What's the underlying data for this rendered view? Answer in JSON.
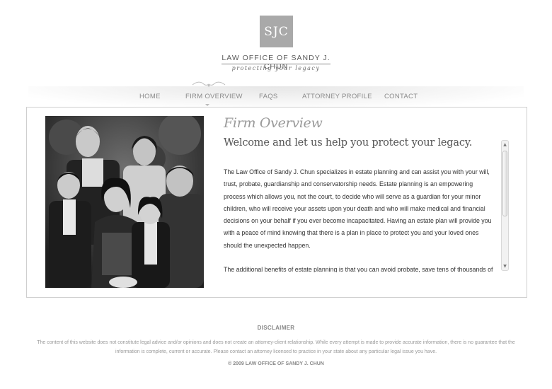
{
  "header": {
    "logo_monogram": "SJC",
    "firm_name": "LAW OFFICE OF SANDY J. CHUN",
    "tagline": "protecting your legacy"
  },
  "nav": {
    "items": [
      {
        "label": "HOME"
      },
      {
        "label": "FIRM OVERVIEW",
        "active": true
      },
      {
        "label": "FAQS"
      },
      {
        "label": "ATTORNEY PROFILE"
      },
      {
        "label": "CONTACT"
      }
    ]
  },
  "main": {
    "section_title": "Firm Overview",
    "headline": "Welcome and let us help you protect your legacy.",
    "paragraphs": [
      "The Law Office of Sandy J. Chun specializes in estate planning and can assist you with your will, trust, probate, guardianship and conservatorship needs. Estate planning is an empowering process which allows you, not the court, to decide who will serve as a guardian for your minor children, who will receive your assets upon your death and who will make medical and financial decisions on your behalf if you ever become incapacitated. Having an estate plan will provide you with a peace of mind knowing that there is a plan in place to protect you and your loved ones should the unexpected happen.",
      "The additional benefits of estate planning is that you can avoid probate, save tens of thousands of"
    ]
  },
  "footer": {
    "disclaimer_title": "DISCLAIMER",
    "disclaimer_text": "The content of this website does not constitute legal advice and/or opinions and does not create an attorney-client relationship. While every attempt is made to provide accurate information, there is no guarantee that the information is complete, current or accurate. Please contact an attorney licensed to practice in your state about any particular legal issue you have.",
    "copyright": "© 2009 LAW OFFICE OF SANDY J. CHUN"
  },
  "colors": {
    "logo_box": "#a9a9a9",
    "nav_text": "#8a8a8a",
    "section_title": "#9a9a9a"
  }
}
